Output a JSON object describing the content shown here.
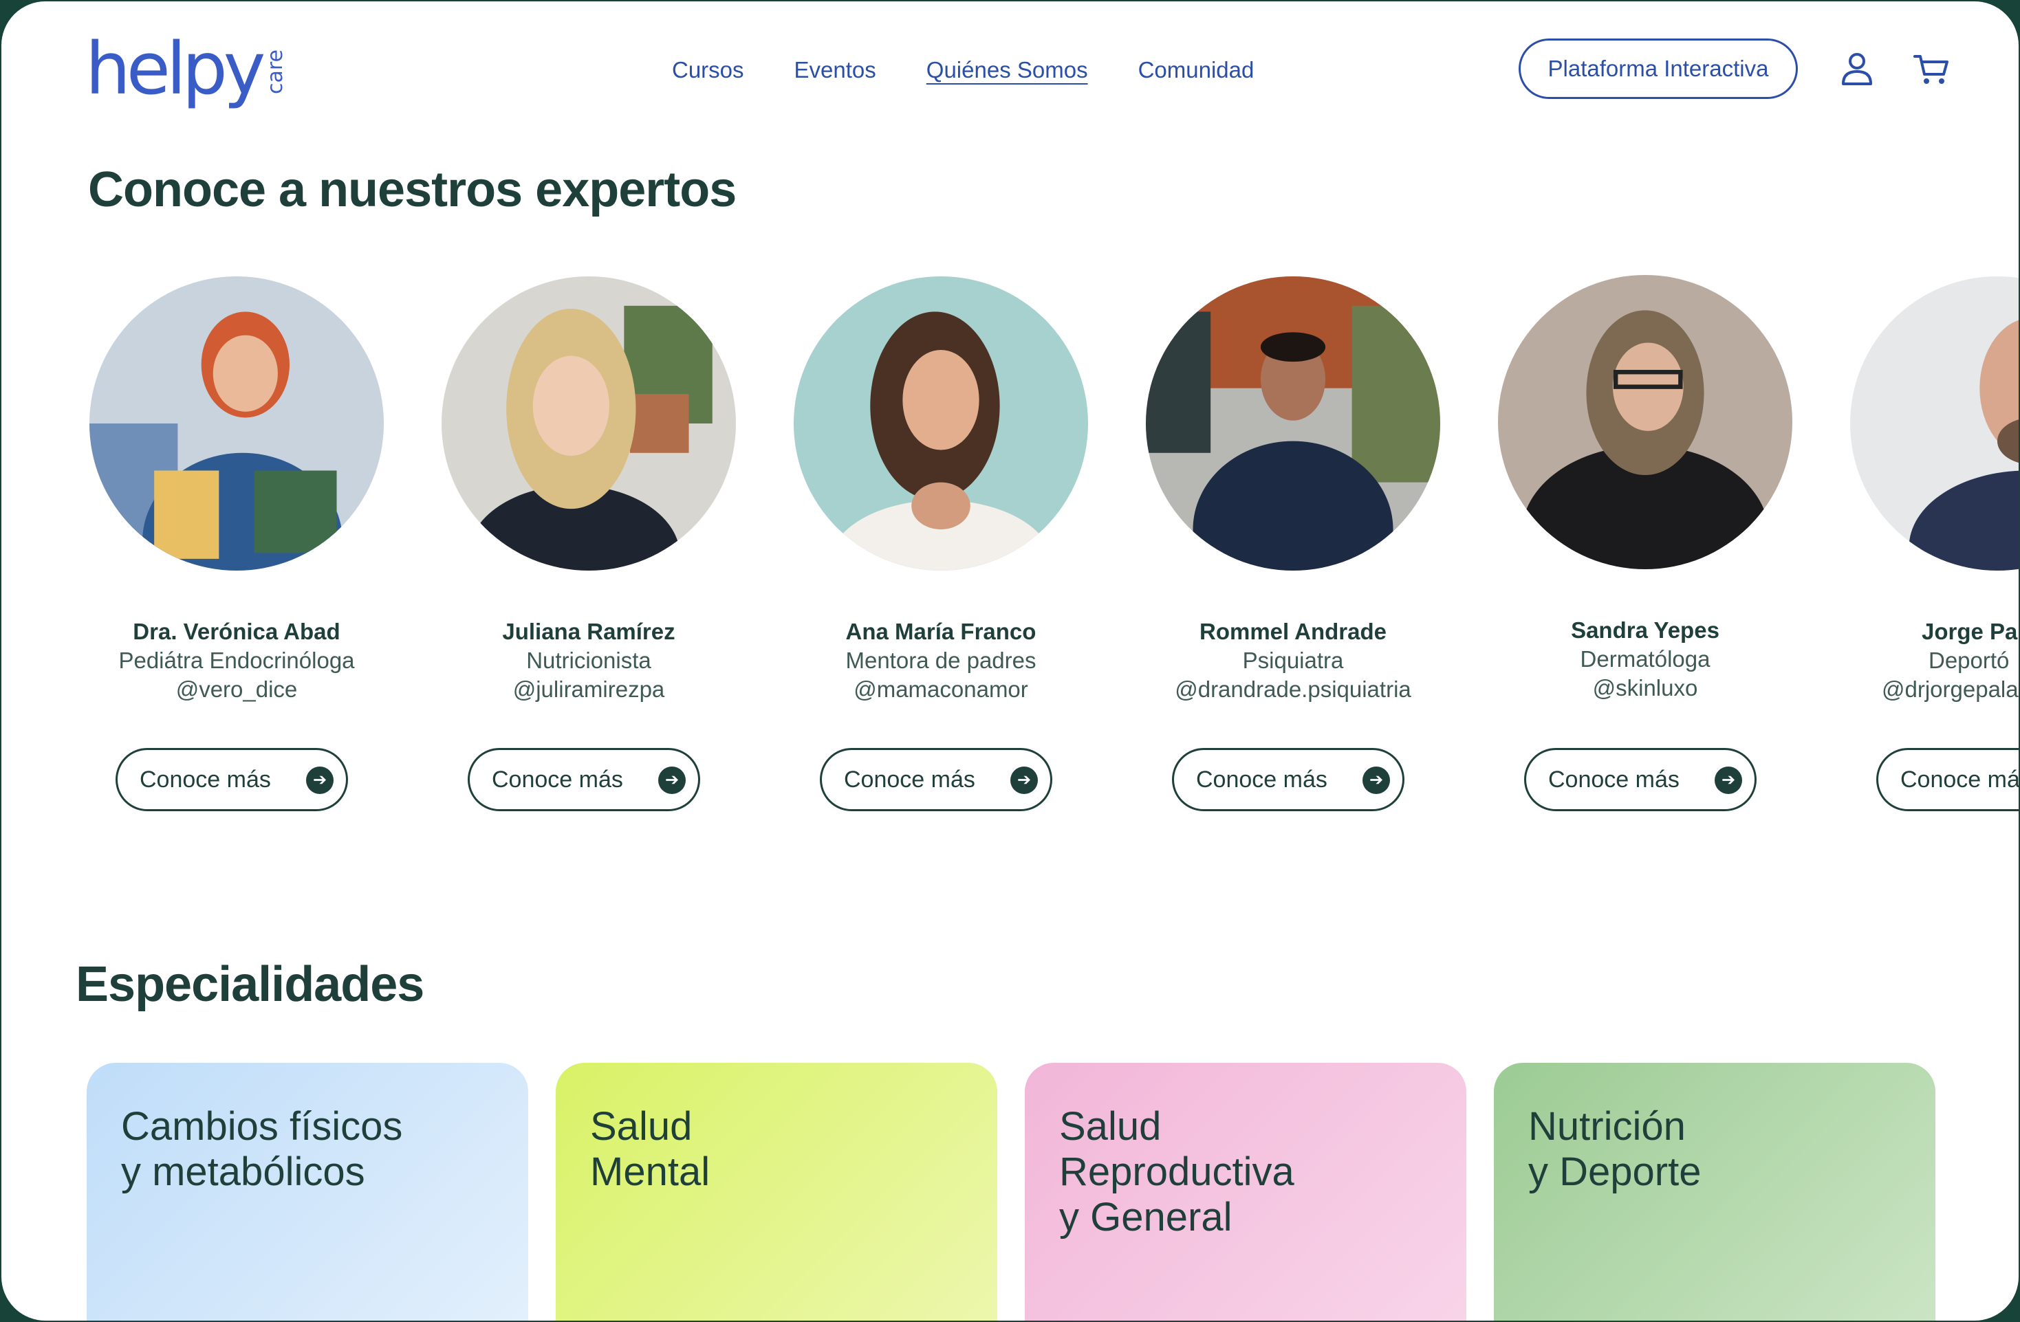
{
  "brand": {
    "logo_text": "helpy",
    "logo_suffix": "care",
    "color": "#3A5CC7"
  },
  "nav": {
    "items": [
      {
        "label": "Cursos",
        "active": false
      },
      {
        "label": "Eventos",
        "active": false
      },
      {
        "label": "Quiénes Somos",
        "active": true
      },
      {
        "label": "Comunidad",
        "active": false
      }
    ],
    "cta_label": "Plataforma Interactiva",
    "icons": [
      "user-icon",
      "cart-icon"
    ]
  },
  "experts_section": {
    "title": "Conoce a nuestros expertos",
    "button_label": "Conoce más",
    "experts": [
      {
        "name": "Dra. Verónica Abad",
        "role": "Pediátra Endocrinóloga",
        "handle": "@vero_dice"
      },
      {
        "name": "Juliana Ramírez",
        "role": "Nutricionista",
        "handle": "@juliramirezpa"
      },
      {
        "name": "Ana María Franco",
        "role": "Mentora de padres",
        "handle": "@mamaconamor"
      },
      {
        "name": "Rommel Andrade",
        "role": "Psiquiatra",
        "handle": "@drandrade.psiquiatria"
      },
      {
        "name": "Sandra Yepes",
        "role": "Dermatóloga",
        "handle": "@skinluxo"
      },
      {
        "name": "Jorge Pa",
        "role": "Deportó",
        "handle": "@drjorgepala"
      }
    ]
  },
  "specialties_section": {
    "title": "Especialidades",
    "cards": [
      {
        "title": "Cambios físicos\ny metabólicos",
        "color": "#CFE4FA"
      },
      {
        "title": "Salud\nMental",
        "color": "#E2F38A"
      },
      {
        "title": "Salud\nReproductiva\ny General",
        "color": "#F4C4E0"
      },
      {
        "title": "Nutrición\ny Deporte",
        "color": "#A9D3A2"
      }
    ]
  },
  "colors": {
    "frame": "#174338",
    "text_dark": "#1F3F3A",
    "nav_blue": "#2B4FA8"
  }
}
